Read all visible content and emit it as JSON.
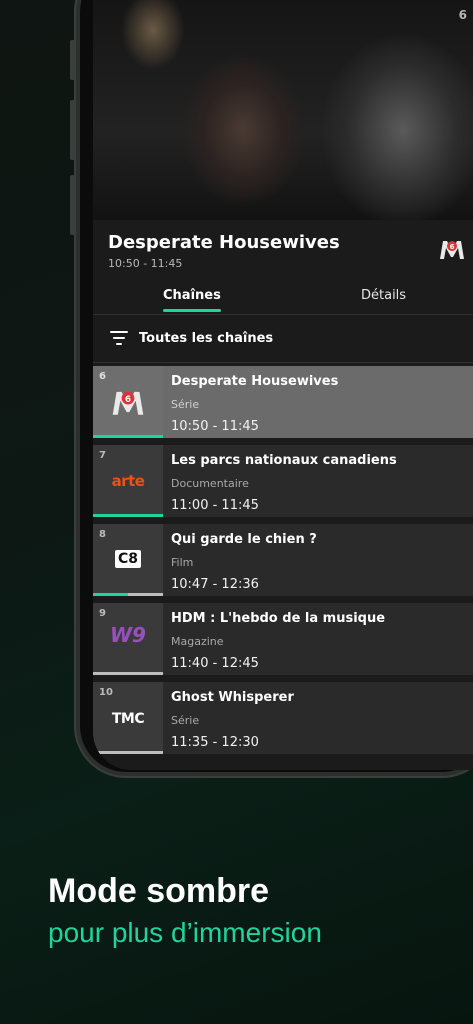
{
  "player": {
    "channel_badge": "6",
    "title": "Desperate Housewives",
    "time": "10:50 - 11:45"
  },
  "tabs": {
    "channels": "Chaînes",
    "details": "Détails"
  },
  "filter": {
    "label": "Toutes les chaînes"
  },
  "rows": [
    {
      "num": "6",
      "logo": "M6",
      "title": "Desperate Housewives",
      "genre": "Série",
      "time": "10:50 - 11:45",
      "progress": 1.0
    },
    {
      "num": "7",
      "logo": "arte",
      "title": "Les parcs nationaux canadiens",
      "genre": "Documentaire",
      "time": "11:00 - 11:45",
      "progress": 1.0
    },
    {
      "num": "8",
      "logo": "C8",
      "title": "Qui garde le chien ?",
      "genre": "Film",
      "time": "10:47 - 12:36",
      "progress": 0.5
    },
    {
      "num": "9",
      "logo": "W9",
      "title": "HDM : L'hebdo de la musique",
      "genre": "Magazine",
      "time": "11:40 - 12:45",
      "progress": 0.0
    },
    {
      "num": "10",
      "logo": "TMC",
      "title": "Ghost Whisperer",
      "genre": "Série",
      "time": "11:35 - 12:30",
      "progress": 0.0
    }
  ],
  "caption": {
    "line1": "Mode sombre",
    "line2": "pour plus d’immersion"
  },
  "colors": {
    "accent": "#1fd59a"
  }
}
